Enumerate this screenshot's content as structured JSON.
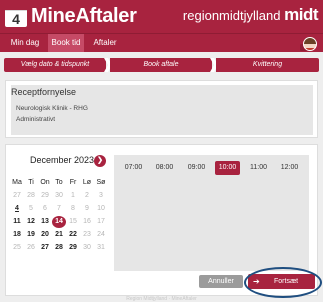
{
  "header": {
    "logo_number": "4",
    "app_title": "MineAftaler",
    "region_text": "regionmidtjylland",
    "region_mark": "midt"
  },
  "nav": {
    "tabs": [
      {
        "label": "Min dag"
      },
      {
        "label": "Book tid"
      },
      {
        "label": "Aftaler"
      }
    ]
  },
  "steps": [
    {
      "label": "Vælg dato & tidspunkt"
    },
    {
      "label": "Book aftale"
    },
    {
      "label": "Kvittering"
    }
  ],
  "info": {
    "title": "Receptfornyelse",
    "lines": [
      "Neurologisk Klinik - RHG",
      "Administrativt"
    ]
  },
  "calendar": {
    "month_label": "December 2023",
    "next_icon": "chevron-right-icon",
    "weekdays": [
      "Ma",
      "Ti",
      "On",
      "To",
      "Fr",
      "Lø",
      "Sø"
    ],
    "rows": [
      [
        "27",
        "28",
        "29",
        "30",
        "1",
        "2",
        "3"
      ],
      [
        "4",
        "5",
        "6",
        "7",
        "8",
        "9",
        "10"
      ],
      [
        "11",
        "12",
        "13",
        "14",
        "15",
        "16",
        "17"
      ],
      [
        "18",
        "19",
        "20",
        "21",
        "22",
        "23",
        "24"
      ],
      [
        "25",
        "26",
        "27",
        "28",
        "29",
        "30",
        "31"
      ]
    ]
  },
  "times": {
    "slots": [
      "07:00",
      "08:00",
      "09:00",
      "10:00",
      "11:00",
      "12:00"
    ],
    "selected": "10:00"
  },
  "actions": {
    "cancel_label": "Annuller",
    "continue_label": "Fortsæt",
    "continue_icon": "arrow-right-icon"
  },
  "footer": {
    "text": "Region Midtjylland · MineAftaler"
  },
  "colors": {
    "brand": "#a8233f",
    "highlight_ring": "#1f4e80"
  }
}
